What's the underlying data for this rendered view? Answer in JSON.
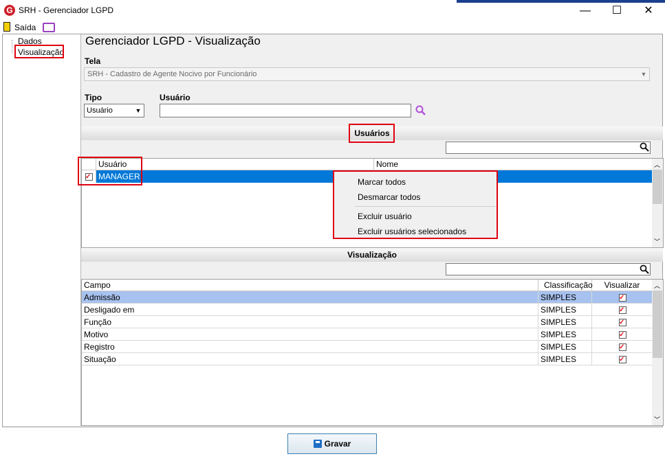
{
  "window": {
    "title": "SRH - Gerenciador LGPD",
    "logo_letter": "G",
    "minimize": "—",
    "maximize": "☐",
    "close": "✕"
  },
  "menu": {
    "exit_label": "Saída"
  },
  "tree": {
    "items": [
      "Dados",
      "Visualização"
    ]
  },
  "page_title": "Gerenciador LGPD - Visualização",
  "tela": {
    "label": "Tela",
    "value": "SRH - Cadastro de Agente Nocivo por Funcionário"
  },
  "tipo": {
    "label": "Tipo",
    "value": "Usuário"
  },
  "usuario": {
    "label": "Usuário",
    "value": ""
  },
  "users_section": {
    "title": "Usuários",
    "columns": [
      "Usuário",
      "Nome"
    ],
    "rows": [
      {
        "checked": true,
        "usuario": "MANAGER",
        "nome": ""
      }
    ]
  },
  "context_menu": {
    "items": [
      "Marcar todos",
      "Desmarcar todos",
      "Excluir usuário",
      "Excluir usuários selecionados"
    ]
  },
  "visual_section": {
    "title": "Visualização",
    "columns": [
      "Campo",
      "Classificação",
      "Visualizar"
    ],
    "rows": [
      {
        "campo": "Admissão",
        "classificacao": "SIMPLES",
        "visualizar": true
      },
      {
        "campo": "Desligado em",
        "classificacao": "SIMPLES",
        "visualizar": true
      },
      {
        "campo": "Função",
        "classificacao": "SIMPLES",
        "visualizar": true
      },
      {
        "campo": "Motivo",
        "classificacao": "SIMPLES",
        "visualizar": true
      },
      {
        "campo": "Registro",
        "classificacao": "SIMPLES",
        "visualizar": true
      },
      {
        "campo": "Situação",
        "classificacao": "SIMPLES",
        "visualizar": true
      }
    ]
  },
  "save_button": {
    "label": "Gravar"
  },
  "colors": {
    "selection": "#0078d7",
    "highlight_row": "#a8c2ef",
    "annotation": "#e00010"
  }
}
